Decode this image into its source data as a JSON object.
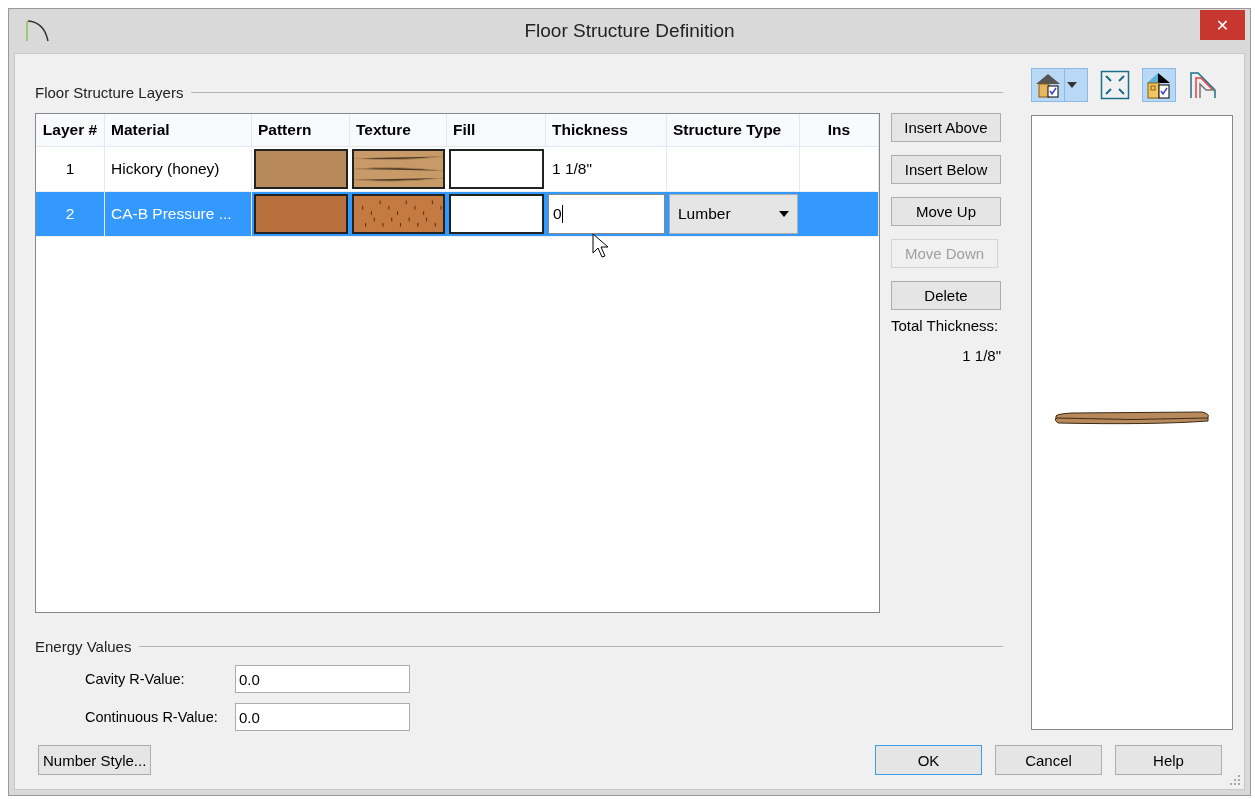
{
  "window": {
    "title": "Floor Structure Definition",
    "close": "✕"
  },
  "layers": {
    "title": "Floor Structure Layers",
    "columns": [
      "Layer #",
      "Material",
      "Pattern",
      "Texture",
      "Fill",
      "Thickness",
      "Structure Type",
      "Ins"
    ],
    "rows": [
      {
        "layer": "1",
        "material": "Hickory (honey)",
        "pattern": {
          "color": "#b8895a"
        },
        "texture": {
          "color": "#c89a68"
        },
        "thickness": "1 1/8\"",
        "editing": false,
        "selected": false
      },
      {
        "layer": "2",
        "material": "CA-B Pressure ...",
        "pattern": {
          "color": "#b8703c"
        },
        "texture": {
          "color": "#c47a40"
        },
        "thickness": "0",
        "editing": true,
        "structure_type": "Lumber",
        "selected": true
      }
    ]
  },
  "actions": [
    {
      "label": "Insert Above",
      "disabled": false
    },
    {
      "label": "Insert Below",
      "disabled": false
    },
    {
      "label": "Move Up",
      "disabled": false
    },
    {
      "label": "Move Down",
      "disabled": true
    },
    {
      "label": "Delete",
      "disabled": false
    }
  ],
  "total_thickness": {
    "label": "Total Thickness:",
    "value": "1 1/8\""
  },
  "preview_tools": [
    {
      "kind": "house-menu",
      "selected": true
    },
    {
      "kind": "fit",
      "selected": false
    },
    {
      "kind": "house-color",
      "selected": true
    },
    {
      "kind": "layers",
      "selected": false
    }
  ],
  "energy": {
    "title": "Energy Values",
    "fields": [
      {
        "label": "Cavity R-Value:",
        "value": "0.0"
      },
      {
        "label": "Continuous R-Value:",
        "value": "0.0"
      }
    ]
  },
  "number_style": "Number Style...",
  "buttons": [
    {
      "label": "OK",
      "default": true
    },
    {
      "label": "Cancel",
      "default": false
    },
    {
      "label": "Help",
      "default": false
    }
  ]
}
